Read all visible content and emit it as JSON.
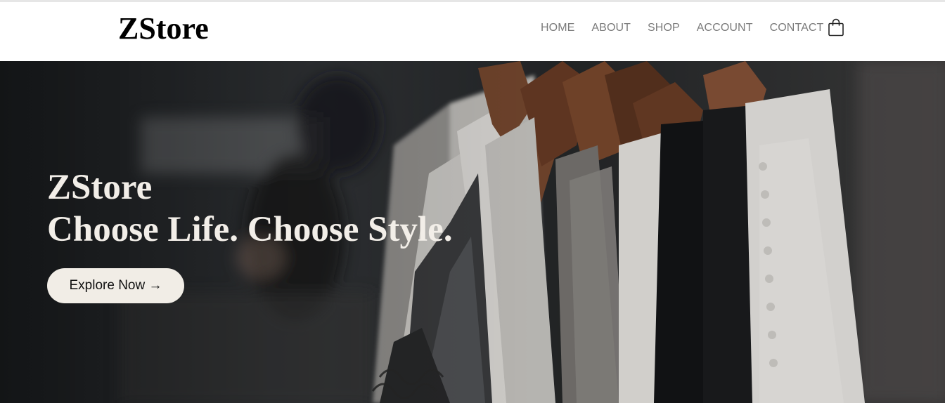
{
  "brand": {
    "logo_text": "ZStore"
  },
  "nav": {
    "items": [
      {
        "label": "HOME"
      },
      {
        "label": "ABOUT"
      },
      {
        "label": "SHOP"
      },
      {
        "label": "ACCOUNT"
      },
      {
        "label": "CONTACT"
      }
    ],
    "cart_icon": "shopping-bag-icon"
  },
  "hero": {
    "title_line1": "ZStore",
    "title_line2": "Choose Life. Choose Style.",
    "button_label": "Explore Now →",
    "background": "clothing-rack-photo"
  },
  "colors": {
    "nav_text": "#7b7b7b",
    "hero_text": "#f2eee8",
    "button_bg": "#f1ede6",
    "hero_bg": "#2a2c2f"
  }
}
